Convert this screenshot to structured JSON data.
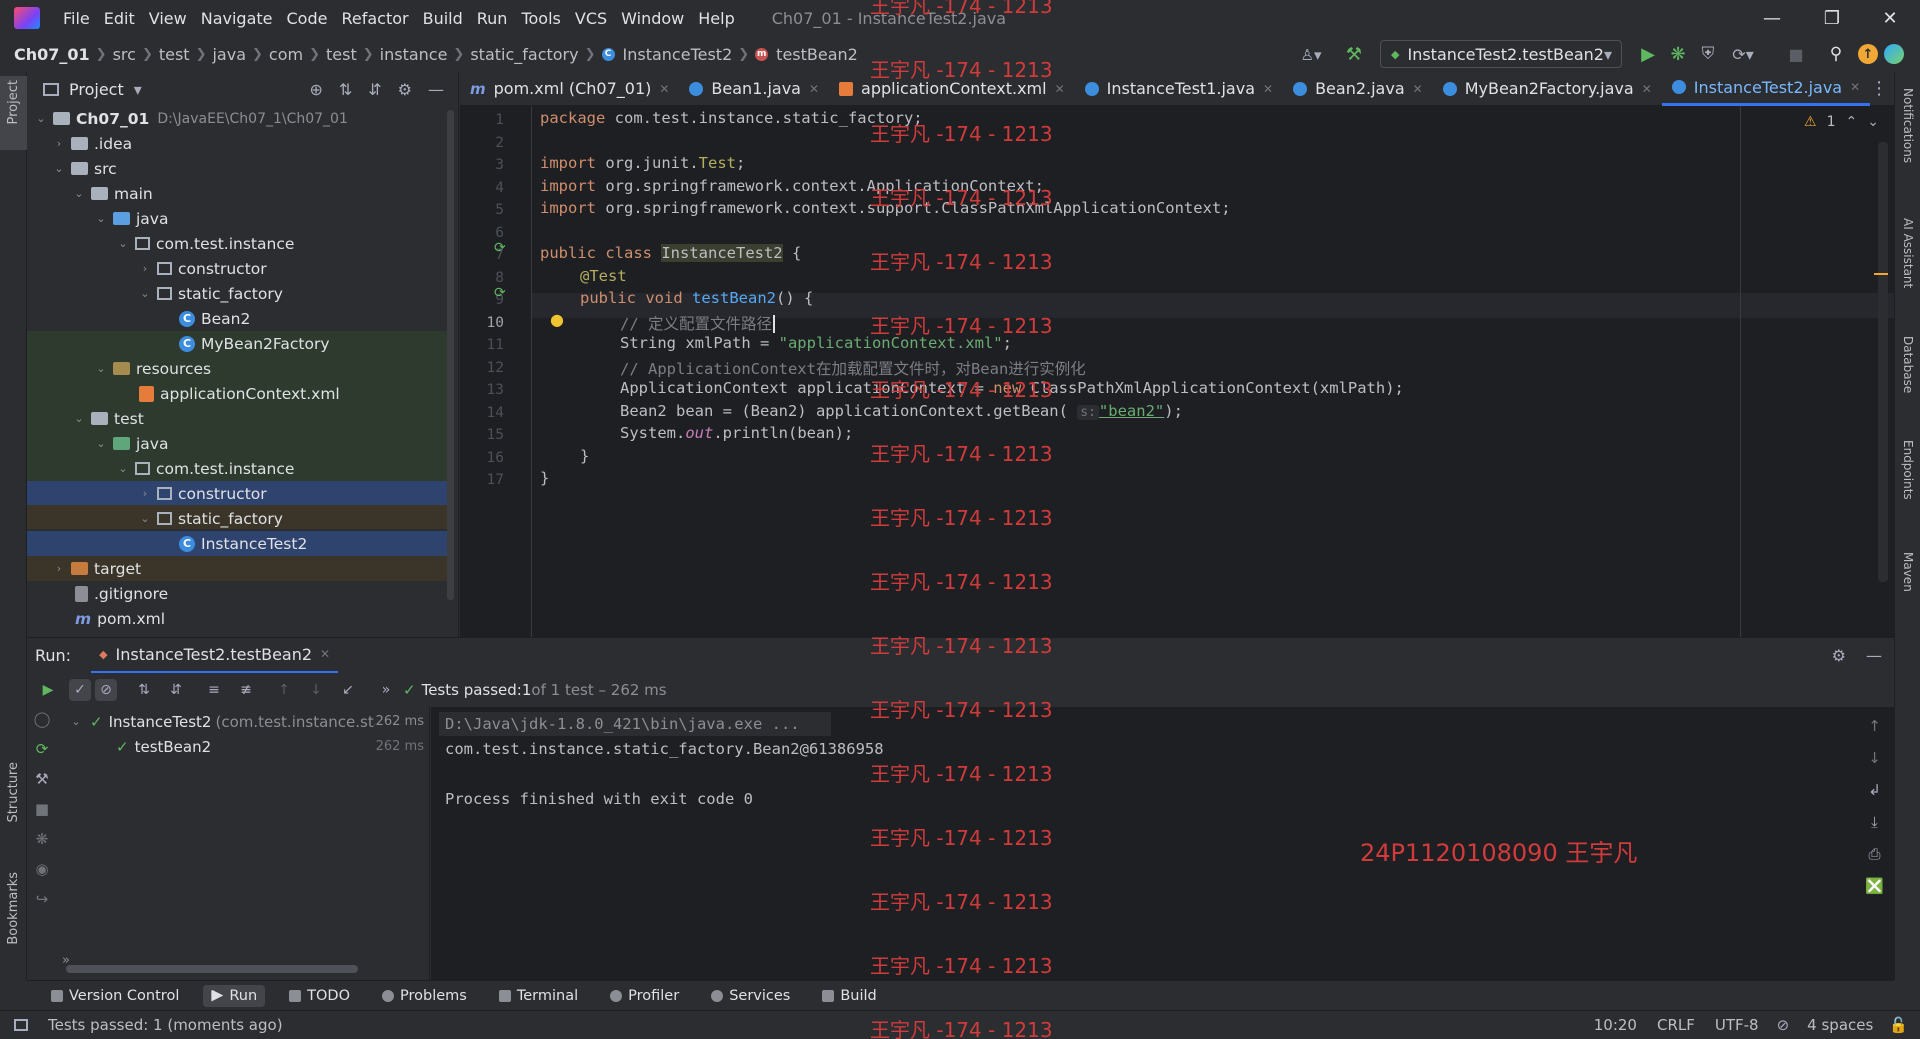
{
  "window": {
    "title": "Ch07_01 - InstanceTest2.java",
    "menu": [
      "File",
      "Edit",
      "View",
      "Navigate",
      "Code",
      "Refactor",
      "Build",
      "Run",
      "Tools",
      "VCS",
      "Window",
      "Help"
    ]
  },
  "breadcrumb": [
    "Ch07_01",
    "src",
    "test",
    "java",
    "com",
    "test",
    "instance",
    "static_factory",
    "InstanceTest2",
    "testBean2"
  ],
  "run_config": "InstanceTest2.testBean2",
  "project_panel": {
    "title": "Project",
    "tree": [
      {
        "label": "Ch07_01",
        "extra": "D:\\JavaEE\\Ch07_1\\Ch07_01"
      },
      {
        "label": ".idea"
      },
      {
        "label": "src"
      },
      {
        "label": "main"
      },
      {
        "label": "java"
      },
      {
        "label": "com.test.instance"
      },
      {
        "label": "constructor"
      },
      {
        "label": "static_factory"
      },
      {
        "label": "Bean2"
      },
      {
        "label": "MyBean2Factory"
      },
      {
        "label": "resources"
      },
      {
        "label": "applicationContext.xml"
      },
      {
        "label": "test"
      },
      {
        "label": "java"
      },
      {
        "label": "com.test.instance"
      },
      {
        "label": "constructor"
      },
      {
        "label": "static_factory"
      },
      {
        "label": "InstanceTest2"
      },
      {
        "label": "target"
      },
      {
        "label": ".gitignore"
      },
      {
        "label": "pom.xml"
      }
    ]
  },
  "tabs": [
    {
      "label": "pom.xml (Ch07_01)"
    },
    {
      "label": "Bean1.java"
    },
    {
      "label": "applicationContext.xml"
    },
    {
      "label": "InstanceTest1.java"
    },
    {
      "label": "Bean2.java"
    },
    {
      "label": "MyBean2Factory.java"
    },
    {
      "label": "InstanceTest2.java"
    }
  ],
  "editor": {
    "warning_count": "1",
    "line_numbers": [
      "1",
      "2",
      "3",
      "4",
      "5",
      "6",
      "7",
      "8",
      "9",
      "10",
      "11",
      "12",
      "13",
      "14",
      "15",
      "16",
      "17"
    ],
    "lines": {
      "l1_kw": "package",
      "l1_rest": " com.test.instance.static_factory;",
      "l3_kw": "import",
      "l3_rest": " org.junit.",
      "l3_cls": "Test",
      "l3_end": ";",
      "l4_kw": "import",
      "l4_rest": " org.springframework.context.ApplicationContext;",
      "l5_kw": "import",
      "l5_rest": " org.springframework.context.support.ClassPathXmlApplicationContext;",
      "l7_kw": "public class",
      "l7_name": "InstanceTest2",
      "l7_end": " {",
      "l8_ann": "@Test",
      "l9_kw": "public void",
      "l9_fn": "testBean2",
      "l9_end": "() {",
      "l10_cmt": "// 定义配置文件路径",
      "l11_a": "String xmlPath = ",
      "l11_str": "\"applicationContext.xml\"",
      "l11_end": ";",
      "l12_cmt": "// ApplicationContext在加载配置文件时，对Bean进行实例化",
      "l13_a": "ApplicationContext applicationContext = ",
      "l13_kw": "new",
      "l13_b": " ClassPathXmlApplicationContext(xmlPath);",
      "l14_a": "Bean2 bean = (Bean2) applicationContext.getBean( ",
      "l14_hint": "s:",
      "l14_str": "\"bean2\"",
      "l14_end": ");",
      "l15_a": "System.",
      "l15_it": "out",
      "l15_b": ".println(bean);",
      "l16": "}",
      "l17": "}"
    }
  },
  "run_panel": {
    "label": "Run:",
    "tab": "InstanceTest2.testBean2",
    "status_prefix": "Tests passed: ",
    "status_count": "1",
    "status_suffix": " of 1 test – 262 ms",
    "tree": [
      {
        "name": "InstanceTest2",
        "pkg": "(com.test.instance.sta",
        "time": "262 ms"
      },
      {
        "name": "testBean2",
        "time": "262 ms"
      }
    ],
    "console": [
      "D:\\Java\\jdk-1.8.0_421\\bin\\java.exe ...",
      "com.test.instance.static_factory.Bean2@61386958",
      "",
      "Process finished with exit code 0"
    ]
  },
  "bottom_tools": [
    "Version Control",
    "Run",
    "TODO",
    "Problems",
    "Terminal",
    "Profiler",
    "Services",
    "Build"
  ],
  "status_bar": {
    "message": "Tests passed: 1 (moments ago)",
    "position": "10:20",
    "line_sep": "CRLF",
    "encoding": "UTF-8",
    "indent": "4 spaces"
  },
  "side_labels": {
    "left": [
      "Project",
      "Structure",
      "Bookmarks"
    ],
    "right": [
      "Notifications",
      "AI Assistant",
      "Database",
      "Endpoints",
      "Maven"
    ]
  },
  "watermark": {
    "repeat": "王宇凡 -174 - 1213",
    "signature": "24P1120108090 王宇凡"
  }
}
